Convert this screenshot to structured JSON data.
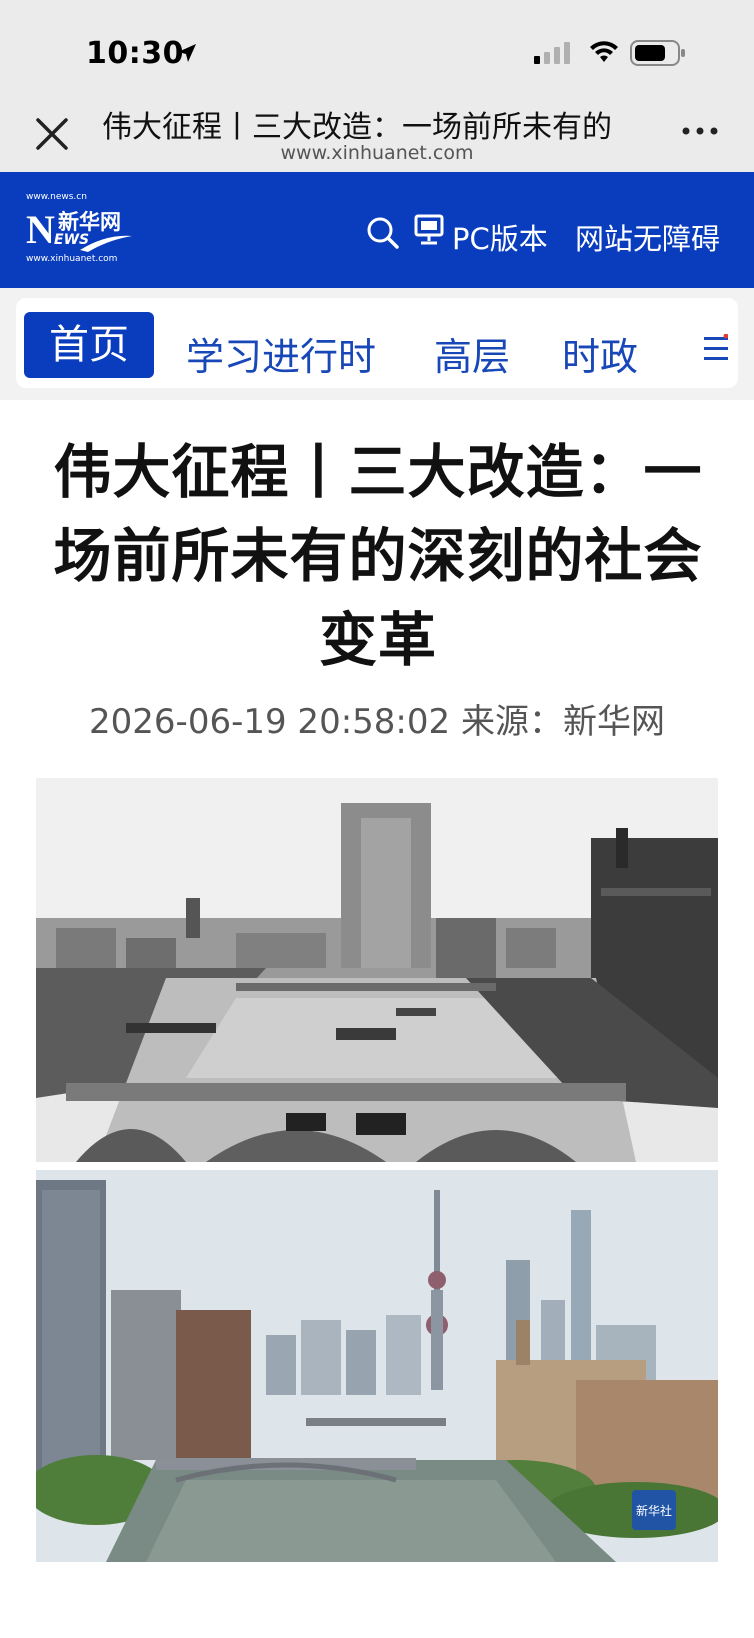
{
  "status_bar": {
    "time": "10:30"
  },
  "browser": {
    "title": "伟大征程丨三大改造：一场前所未有的",
    "url": "www.xinhuanet.com"
  },
  "site_header": {
    "logo_domain": "www.news.cn",
    "logo_letter": "N",
    "logo_cn": "新华网",
    "logo_ews": "EWS",
    "logo_sub": "www.xinhuanet.com",
    "pc_label": "PC版本",
    "accessibility_label": "网站无障碍"
  },
  "nav": {
    "items": [
      "首页",
      "学习进行时",
      "高层",
      "时政"
    ]
  },
  "article": {
    "headline": "伟大征程丨三大改造：一场前所未有的深刻的社会变革",
    "datetime": "2026-06-19 20:58:02",
    "source_label": "来源：",
    "source": "新华网"
  },
  "photos": [
    {
      "alt": "historic black-and-white photo of a river with bridges and buildings"
    },
    {
      "alt": "modern color photo of the same river with city skyline and TV tower"
    }
  ],
  "watermark": "新华社",
  "colors": {
    "brand_blue": "#0a3dbd",
    "nav_text": "#1847b8"
  }
}
